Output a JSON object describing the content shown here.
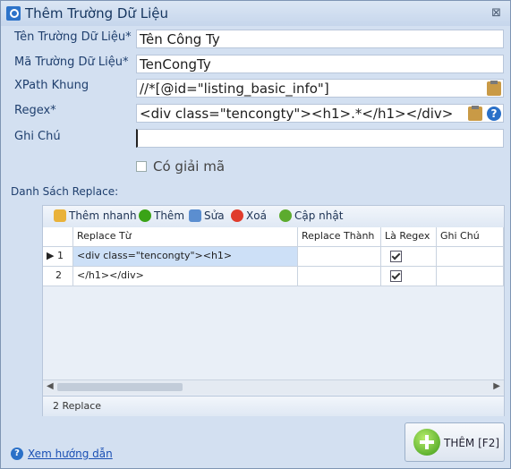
{
  "window": {
    "title": "Thêm Trường Dữ Liệu",
    "close": "⊠"
  },
  "form": {
    "name_label": "Tên Trường Dữ Liệu*",
    "name_value": "Tên  Công Ty",
    "code_label": "Mã Trường Dữ Liệu*",
    "code_value": "TenCongTy",
    "xpath_label": "XPath Khung",
    "xpath_value": "//*[@id=\"listing_basic_info\"]",
    "regex_label": "Regex*",
    "regex_value": "<div class=\"tencongty\"><h1>.*</h1></div>",
    "note_label": "Ghi Chú",
    "note_value": "",
    "decode_label": "Có giải mã",
    "decode_checked": false
  },
  "replace": {
    "section_label": "Danh Sách Replace:",
    "toolbar": {
      "quick_add": "Thêm nhanh",
      "add": "Thêm",
      "edit": "Sửa",
      "delete": "Xoá",
      "update": "Cập nhật"
    },
    "columns": [
      "Replace Từ",
      "Replace Thành",
      "Là Regex",
      "Ghi Chú"
    ],
    "rows": [
      {
        "num": "1",
        "from": "<div class=\"tencongty\"><h1>",
        "to": "",
        "is_regex": true,
        "note": ""
      },
      {
        "num": "2",
        "from": "</h1></div>",
        "to": "",
        "is_regex": true,
        "note": ""
      }
    ],
    "status": "2 Replace"
  },
  "actions": {
    "add_button": "THÊM [F2]",
    "guide_link": "Xem hướng dẫn"
  },
  "colors": {
    "accent": "#2a70c8",
    "window_bg": "#d3e0f1",
    "label": "#1f3f6e",
    "selected_row": "#cde0f7"
  }
}
